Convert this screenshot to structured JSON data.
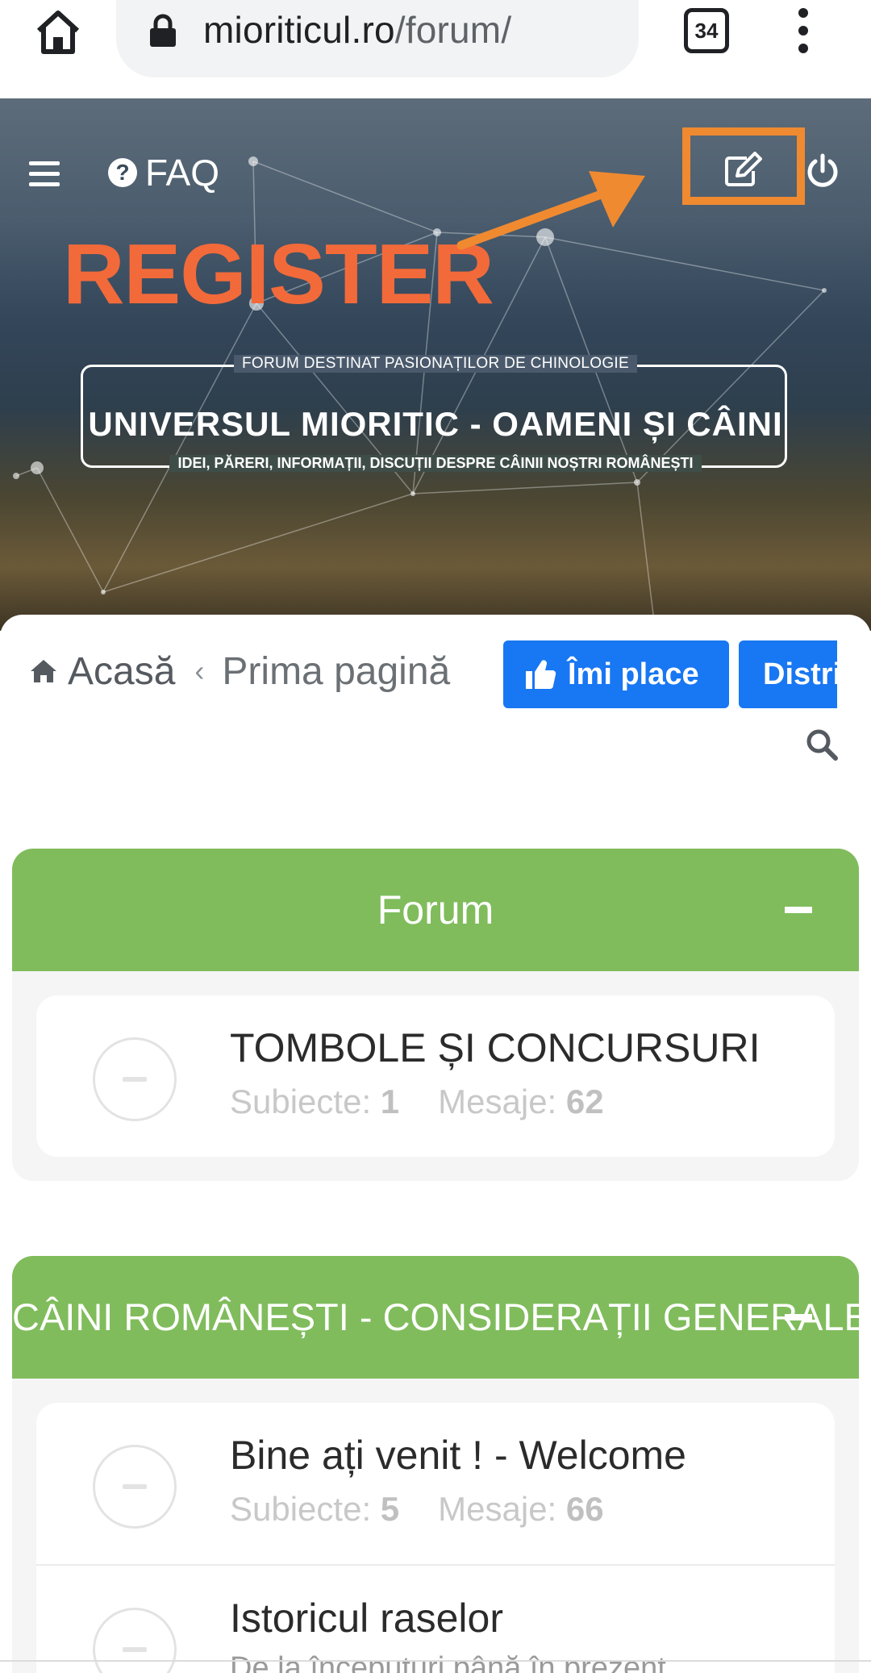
{
  "browser": {
    "url_domain": "mioriticul.ro",
    "url_path": "/forum/",
    "tab_count": "34"
  },
  "header": {
    "faq_label": "FAQ",
    "register_annotation": "REGISTER",
    "tagline_top": "FORUM DESTINAT PASIONAȚILOR DE CHINOLOGIE",
    "site_title": "UNIVERSUL MIORITIC - OAMENI ȘI CÂINI",
    "tagline_bottom": "IDEI, PĂRERI, INFORMAȚII, DISCUȚII DESPRE CÂINII NOȘTRI ROMÂNEȘTI",
    "annotation_color": "#f26a3a"
  },
  "breadcrumb": {
    "home": "Acasă",
    "separator": "‹",
    "current": "Prima pagină"
  },
  "social": {
    "like_label": "Îmi place",
    "share_label": "Distribuie",
    "color": "#1877f2"
  },
  "categories": [
    {
      "title": "Forum",
      "forums": [
        {
          "title": "TOMBOLE ȘI CONCURSURI",
          "topics_label": "Subiecte:",
          "topics": "1",
          "posts_label": "Mesaje:",
          "posts": "62"
        }
      ]
    },
    {
      "title": "CÂINI ROMÂNEȘTI - CONSIDERAȚII GENERALE",
      "forums": [
        {
          "title": "Bine ați venit ! - Welcome",
          "topics_label": "Subiecte:",
          "topics": "5",
          "posts_label": "Mesaje:",
          "posts": "66"
        },
        {
          "title": "Istoricul raselor",
          "description": "De la începuturi până în prezent"
        }
      ]
    }
  ],
  "colors": {
    "category_header": "#80bc5c"
  }
}
